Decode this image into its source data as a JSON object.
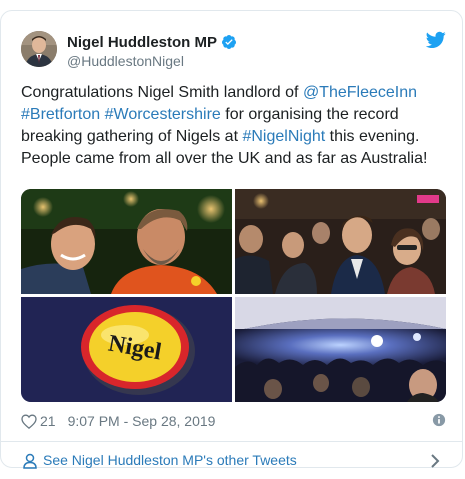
{
  "tweet": {
    "display_name": "Nigel Huddleston MP",
    "handle": "@HuddlestonNigel",
    "text_segments": [
      {
        "t": "Congratulations Nigel Smith landlord of ",
        "link": false
      },
      {
        "t": "@TheFleeceInn",
        "link": true
      },
      {
        "t": " ",
        "link": false
      },
      {
        "t": "#Bretforton",
        "link": true
      },
      {
        "t": " ",
        "link": false
      },
      {
        "t": "#Worcestershire",
        "link": true
      },
      {
        "t": " for organising the record breaking gathering of Nigels at ",
        "link": false
      },
      {
        "t": "#NigelNight",
        "link": true
      },
      {
        "t": " this evening. People came from all over the UK and as far as Australia!",
        "link": false
      }
    ],
    "badge_text": "Nigel",
    "like_count": "21",
    "timestamp": "9:07 PM - Sep 28, 2019",
    "footer_link": "See Nigel Huddleston MP's other Tweets"
  },
  "icons": {
    "verified": "verified-badge-icon",
    "bird": "twitter-bird-icon",
    "heart": "heart-icon",
    "info": "info-icon",
    "user": "user-icon",
    "chevron": "chevron-right-icon"
  },
  "colors": {
    "link": "#2b7bb9",
    "secondary_text": "#697882",
    "verified": "#1da1f2",
    "border": "#e1e8ed",
    "badge_yellow": "#f4d02a",
    "badge_red": "#d8262b"
  }
}
